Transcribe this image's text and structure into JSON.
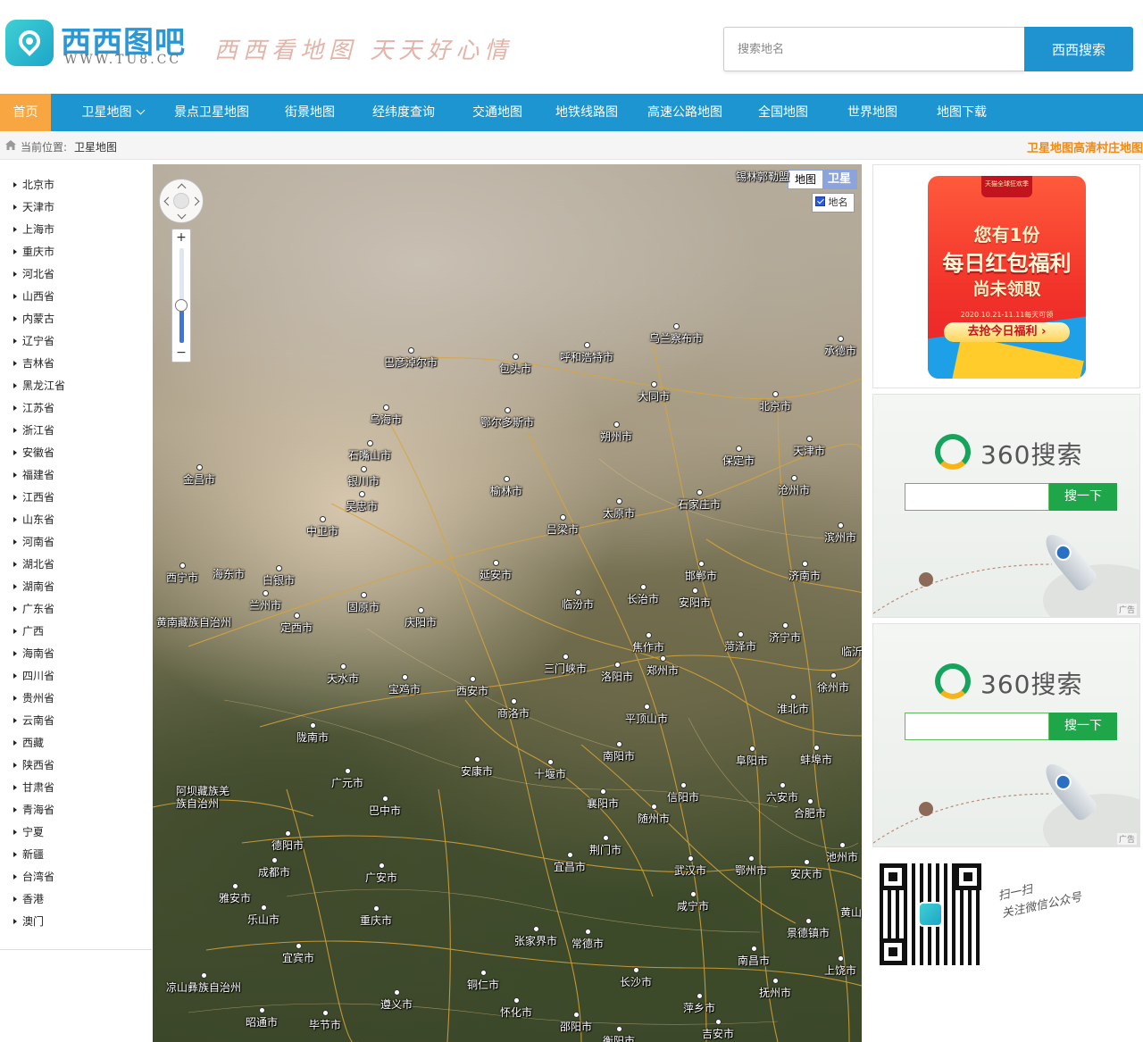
{
  "site": {
    "logo_title": "西西图吧",
    "logo_url": "WWW.TU8.CC",
    "slogan": "西西看地图 天天好心情"
  },
  "search": {
    "placeholder": "搜索地名",
    "button_label": "西西搜索"
  },
  "nav": {
    "items": [
      {
        "label": "首页",
        "active": true
      },
      {
        "label": "卫星地图",
        "has_dropdown": true
      },
      {
        "label": "景点卫星地图"
      },
      {
        "label": "街景地图"
      },
      {
        "label": "经纬度查询"
      },
      {
        "label": "交通地图"
      },
      {
        "label": "地铁线路图"
      },
      {
        "label": "高速公路地图"
      },
      {
        "label": "全国地图"
      },
      {
        "label": "世界地图"
      },
      {
        "label": "地图下载"
      }
    ]
  },
  "breadcrumb": {
    "prefix": "当前位置:",
    "current": "卫星地图",
    "right_link": "卫星地图高清村庄地图"
  },
  "provinces": [
    "北京市",
    "天津市",
    "上海市",
    "重庆市",
    "河北省",
    "山西省",
    "内蒙古",
    "辽宁省",
    "吉林省",
    "黑龙江省",
    "江苏省",
    "浙江省",
    "安徽省",
    "福建省",
    "江西省",
    "山东省",
    "河南省",
    "湖北省",
    "湖南省",
    "广东省",
    "广西",
    "海南省",
    "四川省",
    "贵州省",
    "云南省",
    "西藏",
    "陕西省",
    "甘肃省",
    "青海省",
    "宁夏",
    "新疆",
    "台湾省",
    "香港",
    "澳门"
  ],
  "map": {
    "type_normal": "地图",
    "type_satellite": "卫星",
    "labels_toggle": "地名",
    "labels_checked": true,
    "zoom_in": "+",
    "zoom_out": "−",
    "zoom_level_fraction": 0.4,
    "cities": [
      {
        "name": "锡林郭勒盟"
      },
      {
        "name": "乌兰察布市"
      },
      {
        "name": "承德市"
      },
      {
        "name": "巴彦淖尔市"
      },
      {
        "name": "包头市"
      },
      {
        "name": "呼和浩特市"
      },
      {
        "name": "大同市"
      },
      {
        "name": "北京市"
      },
      {
        "name": "乌海市"
      },
      {
        "name": "鄂尔多斯市"
      },
      {
        "name": "朔州市"
      },
      {
        "name": "天津市"
      },
      {
        "name": "石嘴山市"
      },
      {
        "name": "保定市"
      },
      {
        "name": "金昌市"
      },
      {
        "name": "银川市"
      },
      {
        "name": "榆林市"
      },
      {
        "name": "沧州市"
      },
      {
        "name": "吴忠市"
      },
      {
        "name": "太原市"
      },
      {
        "name": "石家庄市"
      },
      {
        "name": "中卫市"
      },
      {
        "name": "吕梁市"
      },
      {
        "name": "滨州市"
      },
      {
        "name": "西宁市"
      },
      {
        "name": "海东市"
      },
      {
        "name": "白银市"
      },
      {
        "name": "延安市"
      },
      {
        "name": "邯郸市"
      },
      {
        "name": "济南市"
      },
      {
        "name": "兰州市"
      },
      {
        "name": "固原市"
      },
      {
        "name": "临汾市"
      },
      {
        "name": "长治市"
      },
      {
        "name": "安阳市"
      },
      {
        "name": "黄南藏族自治州"
      },
      {
        "name": "定西市"
      },
      {
        "name": "庆阳市"
      },
      {
        "name": "济宁市"
      },
      {
        "name": "焦作市"
      },
      {
        "name": "菏泽市"
      },
      {
        "name": "临沂"
      },
      {
        "name": "三门峡市"
      },
      {
        "name": "郑州市"
      },
      {
        "name": "洛阳市"
      },
      {
        "name": "天水市"
      },
      {
        "name": "宝鸡市"
      },
      {
        "name": "西安市"
      },
      {
        "name": "徐州市"
      },
      {
        "name": "商洛市"
      },
      {
        "name": "淮北市"
      },
      {
        "name": "平顶山市"
      },
      {
        "name": "陇南市"
      },
      {
        "name": "南阳市"
      },
      {
        "name": "阜阳市"
      },
      {
        "name": "蚌埠市"
      },
      {
        "name": "安康市"
      },
      {
        "name": "十堰市"
      },
      {
        "name": "广元市"
      },
      {
        "name": "阿坝藏族羌族自治州"
      },
      {
        "name": "襄阳市"
      },
      {
        "name": "信阳市"
      },
      {
        "name": "六安市"
      },
      {
        "name": "巴中市"
      },
      {
        "name": "随州市"
      },
      {
        "name": "合肥市"
      },
      {
        "name": "德阳市"
      },
      {
        "name": "荆门市"
      },
      {
        "name": "池州市"
      },
      {
        "name": "成都市"
      },
      {
        "name": "宜昌市"
      },
      {
        "name": "武汉市"
      },
      {
        "name": "鄂州市"
      },
      {
        "name": "广安市"
      },
      {
        "name": "安庆市"
      },
      {
        "name": "雅安市"
      },
      {
        "name": "咸宁市"
      },
      {
        "name": "黄山"
      },
      {
        "name": "乐山市"
      },
      {
        "name": "重庆市"
      },
      {
        "name": "景德镇市"
      },
      {
        "name": "张家界市"
      },
      {
        "name": "常德市"
      },
      {
        "name": "宜宾市"
      },
      {
        "name": "南昌市"
      },
      {
        "name": "上饶市"
      },
      {
        "name": "凉山彝族自治州"
      },
      {
        "name": "铜仁市"
      },
      {
        "name": "长沙市"
      },
      {
        "name": "抚州市"
      },
      {
        "name": "遵义市"
      },
      {
        "name": "怀化市"
      },
      {
        "name": "萍乡市"
      },
      {
        "name": "昭通市"
      },
      {
        "name": "毕节市"
      },
      {
        "name": "邵阳市"
      },
      {
        "name": "衡阳市"
      },
      {
        "name": "吉安市"
      }
    ]
  },
  "ads": {
    "redpacket": {
      "store": "天猫全球狂欢季",
      "line1": "您有1份",
      "line2": "每日红包福利",
      "line3": "尚未领取",
      "date": "2020.10.21-11.11每天可领",
      "cta": "去抢今日福利 ›"
    },
    "search360": {
      "brand": "360搜索",
      "button": "搜一下",
      "tag": "广告"
    }
  },
  "qr": {
    "caption_line1": "扫一扫",
    "caption_line2": "关注微信公众号"
  },
  "colors": {
    "nav_bg": "#1d95d0",
    "nav_active": "#f7a642",
    "brand_blue": "#1f93cf",
    "breadcrumb_right": "#f08a17"
  }
}
